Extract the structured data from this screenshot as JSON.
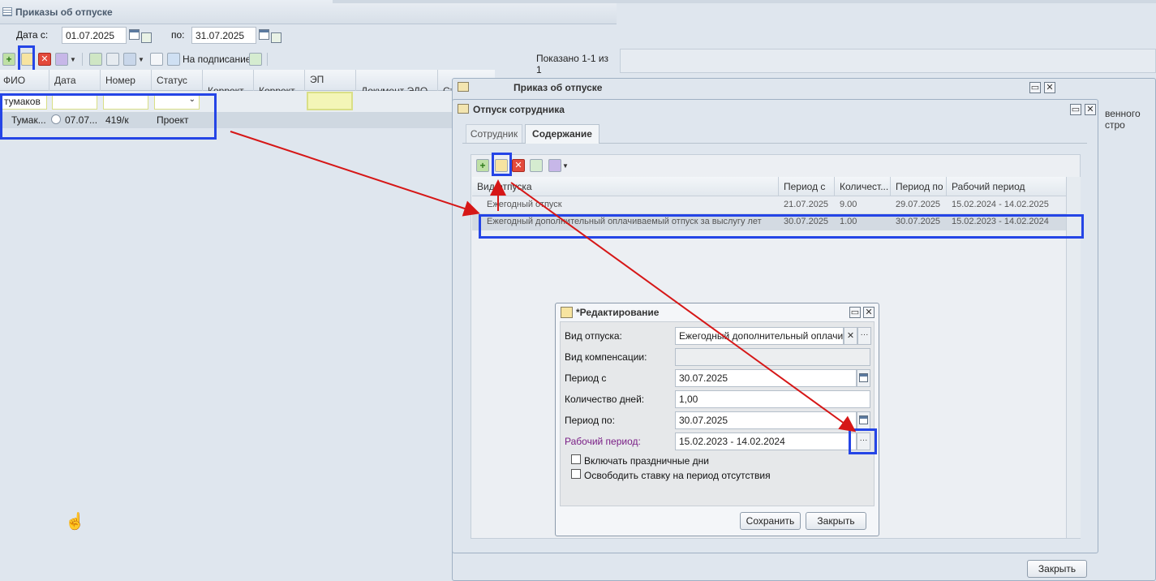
{
  "orders_panel": {
    "title": "Приказы об отпуске",
    "date_from_label": "Дата с:",
    "date_from": "01.07.2025",
    "date_to_label": "по:",
    "date_to": "31.07.2025",
    "sign_button": "На подписание",
    "shown": "Показано 1-1 из 1",
    "columns": [
      "ФИО",
      "Дата",
      "Номер",
      "Статус",
      "Коррект...",
      "Коррект...",
      "ЭП",
      "Документ ЭДО",
      "Статус доку"
    ],
    "filter_fio": "тумаков",
    "row": {
      "fio": "Тумак...",
      "date": "07.07...",
      "number": "419/к",
      "status": "Проект"
    }
  },
  "order_window": {
    "title": "Приказ об отпуске",
    "partial_text": "венного стро",
    "close_button": "Закрыть"
  },
  "employee_window": {
    "title": "Отпуск сотрудника",
    "tabs": [
      "Сотрудник",
      "Содержание"
    ],
    "columns": [
      "Вид отпуска",
      "Период с",
      "Количест...",
      "Период по",
      "Рабочий период"
    ],
    "rows": [
      {
        "type": "Ежегодный отпуск",
        "from": "21.07.2025",
        "days": "9.00",
        "to": "29.07.2025",
        "period": "15.02.2024 - 14.02.2025"
      },
      {
        "type": "Ежегодный дополнительный оплачиваемый отпуск за выслугу лет",
        "from": "30.07.2025",
        "days": "1.00",
        "to": "30.07.2025",
        "period": "15.02.2023 - 14.02.2024"
      }
    ]
  },
  "edit_dialog": {
    "title": "*Редактирование",
    "leave_type_label": "Вид отпуска:",
    "leave_type_value": "Ежегодный дополнительный оплачи",
    "compensation_label": "Вид компенсации:",
    "compensation_value": "",
    "period_from_label": "Период с",
    "period_from_value": "30.07.2025",
    "days_label": "Количество дней:",
    "days_value": "1,00",
    "period_to_label": "Период по:",
    "period_to_value": "30.07.2025",
    "work_period_label": "Рабочий период:",
    "work_period_value": "15.02.2023 - 14.02.2024",
    "holidays_checkbox": "Включать праздничные дни",
    "free_rate_checkbox": "Освободить ставку на период отсутствия",
    "save_button": "Сохранить",
    "close_button": "Закрыть"
  },
  "colors": {
    "highlight": "#2545e6",
    "arrow": "#d61717",
    "work_period_label": "#7a1f86"
  }
}
